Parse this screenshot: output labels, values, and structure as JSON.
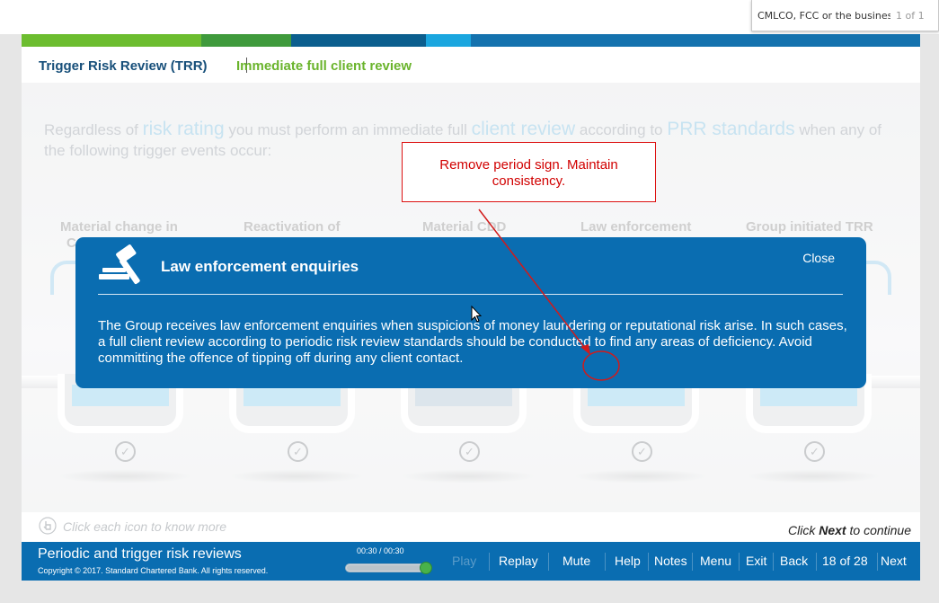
{
  "find_bar": {
    "text": "CMLCO, FCC or the business",
    "count": "1 of 1"
  },
  "header": {
    "crumb1": "Trigger Risk Review (TRR)",
    "crumb2": "Immediate full client review"
  },
  "intro": {
    "t1": "Regardless of ",
    "h1": "risk rating",
    "t2": " you must perform an immediate full ",
    "h2": "client review",
    "t3": " according to ",
    "h3": "PRR standards",
    "t4": " when any of the following trigger events occur:"
  },
  "tiles": [
    {
      "title": "Material change in",
      "sub": "C"
    },
    {
      "title": "Reactivation of"
    },
    {
      "title": "Material CDD"
    },
    {
      "title": "Law enforcement"
    },
    {
      "title": "Group initiated TRR"
    }
  ],
  "colors": {
    "tile_fill": "#b3dff3",
    "tile_fill_mid": "#c9d7e2",
    "brand_blue": "#0a6db1",
    "brand_green": "#6cbd2f"
  },
  "hint": "Click each icon to know more",
  "continue_prefix": "Click ",
  "continue_strong": "Next",
  "continue_suffix": " to continue",
  "modal": {
    "title": "Law enforcement enquiries",
    "close_label": "Close",
    "body": "The Group receives law enforcement enquiries when suspicions of money laundering or reputational risk arise. In such cases, a full client review according to periodic risk review standards should be conducted to find any areas of deficiency. Avoid committing the offence of tipping off during any client contact."
  },
  "annotation": {
    "text": "Remove period sign. Maintain consistency."
  },
  "footer": {
    "course_title": "Periodic and trigger risk reviews",
    "copyright": "Copyright © 2017. Standard Chartered Bank. All rights reserved.",
    "time": "00:30 / 00:30",
    "progress": 1.0,
    "play": "Play",
    "replay": "Replay",
    "mute": "Mute",
    "help": "Help",
    "notes": "Notes",
    "menu": "Menu",
    "exit": "Exit",
    "back": "Back",
    "page": "18 of 28",
    "next": "Next"
  }
}
